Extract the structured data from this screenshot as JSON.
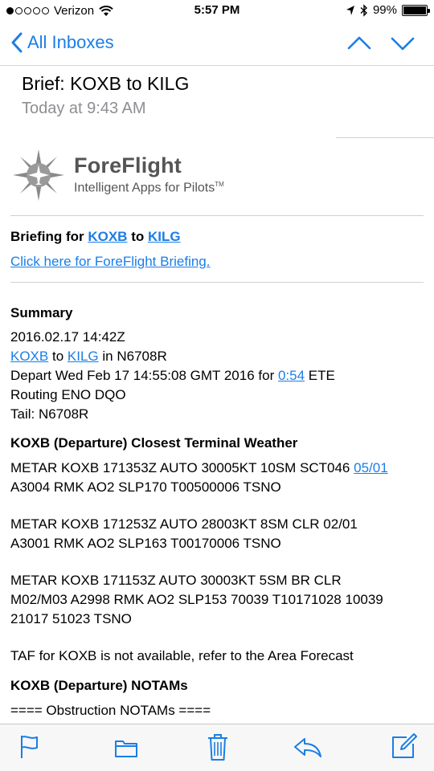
{
  "status_bar": {
    "carrier": "Verizon",
    "time": "5:57 PM",
    "battery": "99%",
    "signal_bars_filled": 1,
    "signal_bars_total": 5,
    "battery_level": 0.99
  },
  "nav": {
    "back_label": "All Inboxes",
    "accent_color": "#1a7ee6",
    "icons": {
      "back": "chevron-left-icon",
      "previous": "chevron-up-icon",
      "next": "chevron-down-icon"
    }
  },
  "message": {
    "subject": "Brief: KOXB to KILG",
    "date": "Today at 9:43 AM"
  },
  "logo": {
    "brand": "ForeFlight",
    "tagline": "Intelligent Apps for Pilots",
    "trademark": "TM"
  },
  "briefing": {
    "prefix": "Briefing for",
    "origin": "KOXB",
    "connector": "to",
    "destination": "KILG",
    "link_label": "Click here for ForeFlight Briefing."
  },
  "summary": {
    "heading": "Summary",
    "datetime": "2016.02.17 14:42Z",
    "route_origin": "KOXB",
    "route_to": "to",
    "route_destination": "KILG",
    "route_suffix": "in N6708R",
    "depart_prefix": "Depart Wed Feb 17 14:55:08 GMT 2016 for",
    "ete_value": "0:54",
    "ete_label": "ETE",
    "routing": "Routing ENO DQO",
    "tail": "Tail: N6708R"
  },
  "weather": {
    "heading": "KOXB (Departure) Closest Terminal Weather",
    "metar1_a": "METAR KOXB 171353Z AUTO 30005KT 10SM SCT046",
    "metar1_link": "05/01",
    "metar1_b": "A3004 RMK AO2 SLP170 T00500006 TSNO",
    "metar2_a": "METAR KOXB 171253Z AUTO 28003KT 8SM CLR 02/01",
    "metar2_b": "A3001 RMK AO2 SLP163 T00170006 TSNO",
    "metar3_a": "METAR KOXB 171153Z AUTO 30003KT 5SM BR CLR",
    "metar3_b": "M02/M03 A2998 RMK AO2 SLP153 70039 T10171028 10039",
    "metar3_c": "21017 51023 TSNO",
    "taf": "TAF for KOXB is not available, refer to the Area Forecast"
  },
  "notams": {
    "heading": "KOXB (Departure) NOTAMs",
    "obstruction": "==== Obstruction NOTAMs ===="
  },
  "toolbar": {
    "icons": [
      "flag-icon",
      "folder-icon",
      "trash-icon",
      "reply-icon",
      "compose-icon"
    ]
  }
}
